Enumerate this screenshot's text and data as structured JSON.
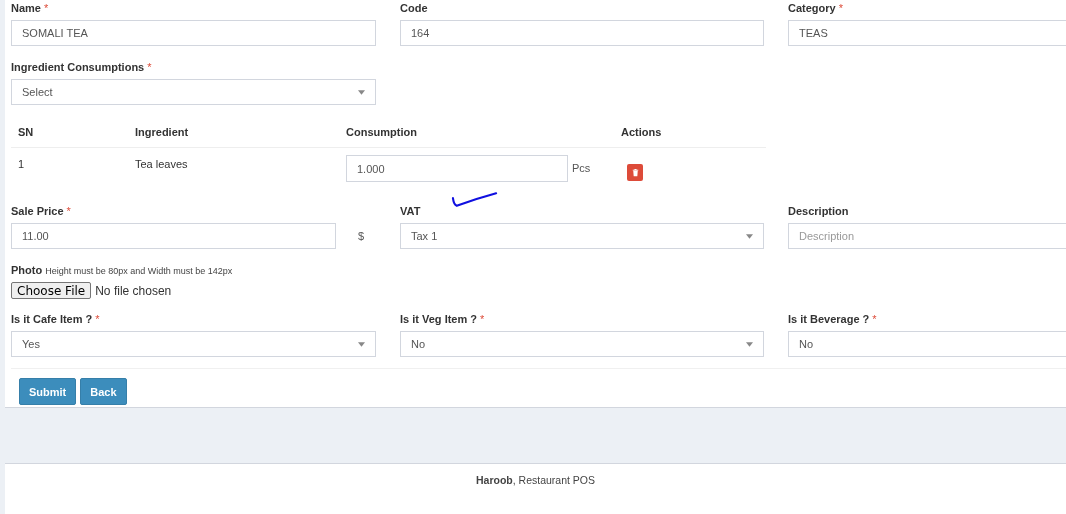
{
  "form": {
    "row_1": [
      {
        "kind": "text",
        "label": "Name",
        "mark": "*",
        "value": "SOMALI TEA"
      },
      {
        "kind": "text",
        "label": "Code",
        "value": "164"
      },
      {
        "kind": "text",
        "label": "Category",
        "mark": "*",
        "value": "TEAS"
      }
    ],
    "ingredient_select": {
      "kind": "select",
      "label": "Ingredient Consumptions",
      "mark": "*",
      "value": "Select"
    },
    "ingredients_table": {
      "columns": [
        "SN",
        "Ingredient",
        "Consumption",
        "Actions"
      ],
      "rows": [
        {
          "sn": "1",
          "ingredient": "Tea leaves",
          "consumption": "1.000",
          "unit": "Pcs"
        }
      ]
    },
    "row_2": [
      {
        "kind": "text",
        "label": "Sale Price",
        "mark": "*",
        "value": "11.00",
        "suffix": "$"
      },
      {
        "kind": "select",
        "label": "VAT",
        "value": "Tax 1"
      },
      {
        "kind": "text",
        "label": "Description",
        "placeholder": "Description"
      }
    ],
    "photo": {
      "label": "Photo",
      "hint": "Height must be 80px and Width must be 142px",
      "button": "Choose File",
      "status": "No file chosen"
    },
    "row_3": [
      {
        "kind": "select",
        "label": "Is it Cafe Item ?",
        "mark": "*",
        "value": "Yes"
      },
      {
        "kind": "select",
        "label": "Is it Veg Item ?",
        "mark": "*",
        "value": "No"
      },
      {
        "kind": "select",
        "label": "Is it Beverage ?",
        "mark": "*",
        "value": "No"
      }
    ],
    "buttons": [
      "Submit",
      "Back"
    ]
  },
  "footer": "**Haroob**, Restaurant POS"
}
